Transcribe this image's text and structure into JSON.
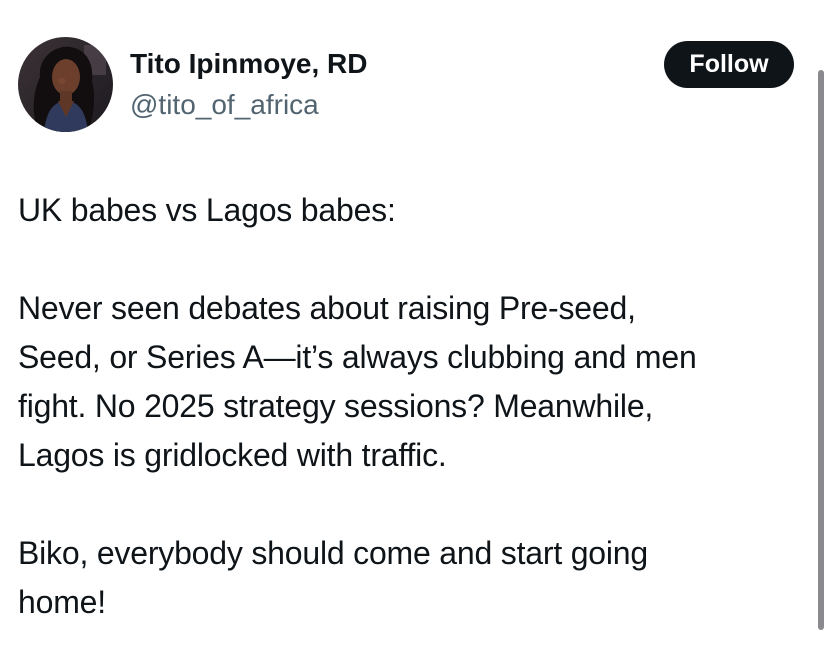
{
  "author": {
    "name": "Tito Ipinmoye, RD",
    "handle": "@tito_of_africa",
    "avatar": "profile-photo"
  },
  "follow_button": {
    "label": "Follow"
  },
  "tweet": {
    "paragraphs": [
      {
        "lines": [
          "UK babes vs Lagos babes:"
        ]
      },
      {
        "lines": [
          "Never seen debates about raising Pre-seed,",
          "Seed, or Series A—it’s always clubbing and men",
          "fight. No 2025 strategy sessions? Meanwhile,",
          "Lagos is gridlocked with traffic."
        ]
      },
      {
        "lines": [
          "Biko, everybody should come and start going",
          "home!"
        ]
      }
    ]
  },
  "colors": {
    "text": "#0f1419",
    "secondary_text": "#536471",
    "button_bg": "#0f1419",
    "button_text": "#ffffff",
    "scrollbar": "#8a8a8e"
  }
}
